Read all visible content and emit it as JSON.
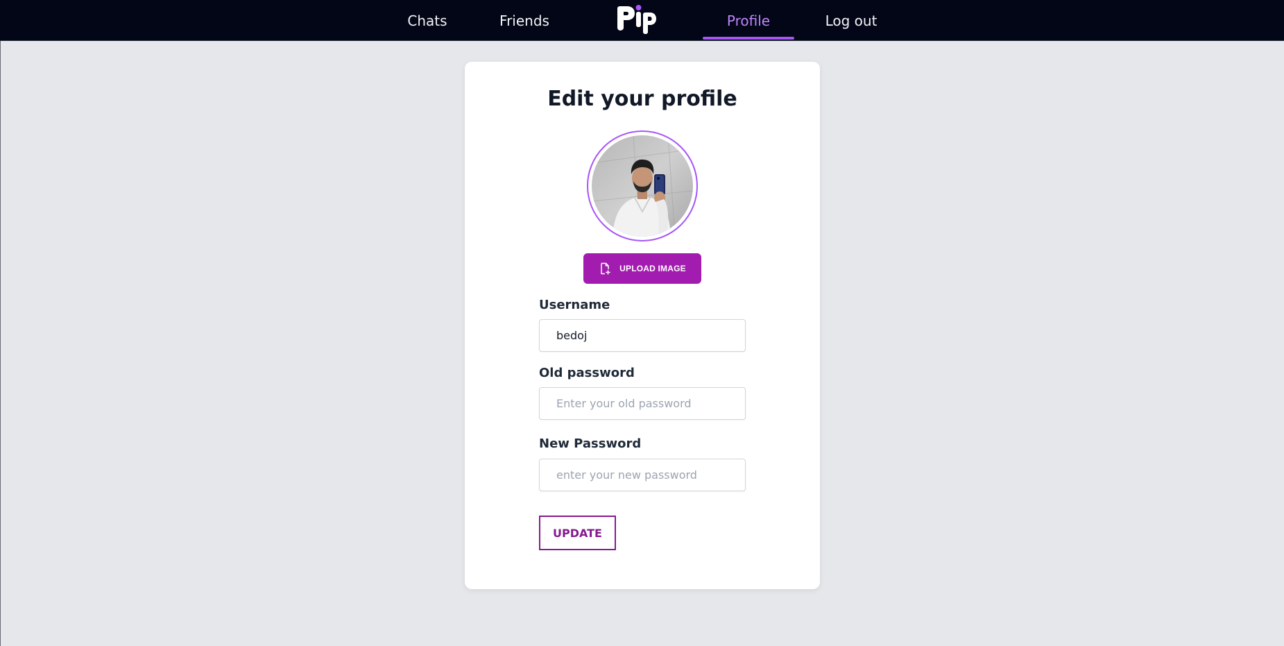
{
  "nav": {
    "chats": "Chats",
    "friends": "Friends",
    "logo_text": "Pip",
    "profile": "Profile",
    "logout": "Log out",
    "active": "profile"
  },
  "card": {
    "title": "Edit your profile",
    "upload_label": "UPLOAD IMAGE",
    "username_label": "Username",
    "username_value": "bedoj",
    "old_password_label": "Old password",
    "old_password_placeholder": "Enter your old password",
    "new_password_label": "New Password",
    "new_password_placeholder": "enter your new password",
    "update_label": "UPDATE"
  },
  "colors": {
    "nav_bg": "#020617",
    "accent": "#a855f7",
    "upload_bg": "#a21caf",
    "update_border": "#86198f",
    "page_bg": "#e5e7eb"
  },
  "icons": {
    "logo": "pip-logo",
    "upload": "file-plus-icon",
    "avatar": "profile-photo"
  }
}
